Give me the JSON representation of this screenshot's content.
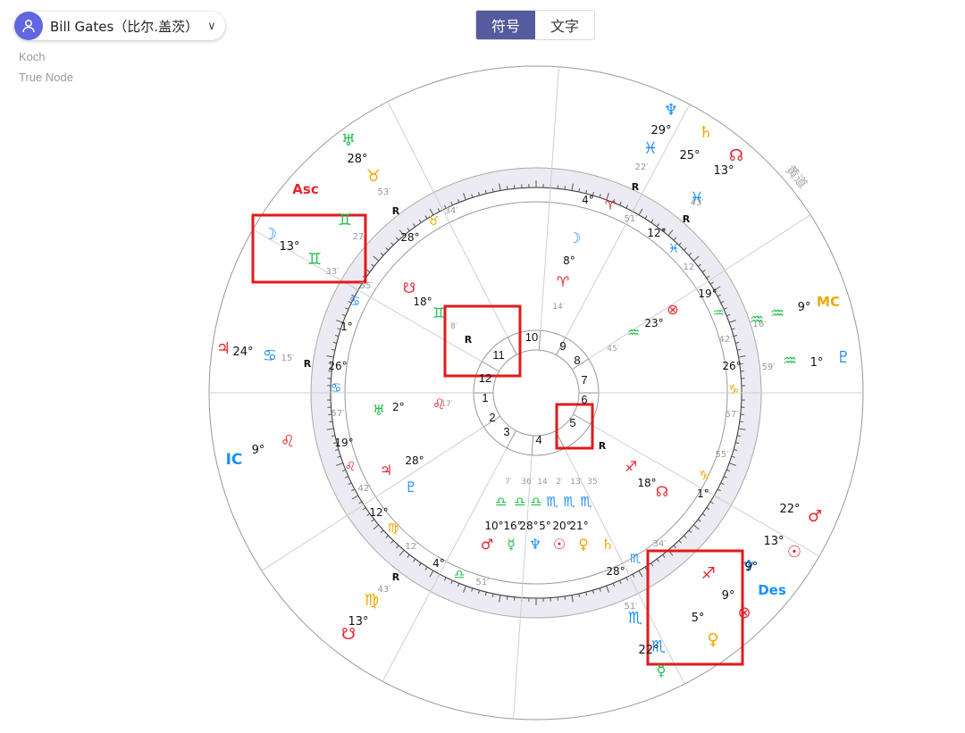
{
  "profile": {
    "name": "Bill Gates（比尔.盖茨）",
    "chevron": "∨"
  },
  "settings": {
    "house_system": "Koch",
    "node_type": "True Node"
  },
  "view_toggle": {
    "symbol_label": "符号",
    "text_label": "文字",
    "active": "symbol"
  },
  "colors": {
    "accent": "#565a9f",
    "fire": "#e8232a",
    "earth": "#f0a800",
    "air": "#1fbf4a",
    "water": "#1a8fff",
    "highlight": "#e21a1a"
  },
  "chart_labels": {
    "ecliptic": "黄道",
    "asc": "Asc",
    "mc": "MC",
    "ic": "IC",
    "des": "Des",
    "retro": "R"
  },
  "house_numbers": [
    "1",
    "2",
    "3",
    "4",
    "5",
    "6",
    "7",
    "8",
    "9",
    "10",
    "11",
    "12"
  ],
  "outer_ring": [
    {
      "glyph": "♅",
      "text": "28°",
      "glyph_color": "#1fbf4a"
    },
    {
      "glyph": "♉",
      "text": "53′",
      "glyph_color": "#f0a800"
    },
    {
      "glyph": "♆",
      "text": "29°",
      "glyph_color": "#1a8fff"
    },
    {
      "glyph": "♄",
      "text": "25°",
      "glyph_color": "#f0a800"
    },
    {
      "glyph": "☊",
      "text": "13°",
      "glyph_color": "#e8232a"
    },
    {
      "glyph": "♓",
      "text": "22′",
      "glyph_color": "#1a8fff"
    },
    {
      "glyph": "♓",
      "text": "43′",
      "glyph_color": "#1a8fff"
    },
    {
      "glyph": "☽",
      "text": "13°",
      "glyph_color": "#1a8fff"
    },
    {
      "glyph": "♊",
      "text": "27′",
      "glyph_color": "#1fbf4a"
    },
    {
      "glyph": "♊",
      "text": "33′",
      "glyph_color": "#1fbf4a"
    },
    {
      "glyph": "♃",
      "text": "24°",
      "glyph_color": "#e8232a"
    },
    {
      "glyph": "♋",
      "text": "15′",
      "glyph_color": "#1a8fff"
    },
    {
      "glyph": "♌",
      "text": "9°",
      "glyph_color": "#e8232a"
    },
    {
      "glyph": "☋",
      "text": "13°",
      "glyph_color": "#e8232a"
    },
    {
      "glyph": "♍",
      "text": "43′",
      "glyph_color": "#f0a800"
    },
    {
      "glyph": "♏",
      "text": "51′",
      "glyph_color": "#1a8fff"
    },
    {
      "glyph": "♏",
      "text": "22°",
      "glyph_color": "#1a8fff"
    },
    {
      "glyph": "☿",
      "text": "",
      "glyph_color": "#1fbf4a"
    },
    {
      "glyph": "♂",
      "text": "22°",
      "glyph_color": "#e8232a"
    },
    {
      "glyph": "☉",
      "text": "13°",
      "glyph_color": "#e8232a"
    },
    {
      "glyph": "♆",
      "text": "9°",
      "glyph_color": "#1a8fff"
    },
    {
      "glyph": "♐",
      "text": "9°",
      "glyph_color": "#e8232a"
    },
    {
      "glyph": "♀",
      "text": "5°",
      "glyph_color": "#f0a800"
    },
    {
      "glyph": "⊗",
      "text": "",
      "glyph_color": "#e8232a"
    },
    {
      "glyph": "♒",
      "text": "16′",
      "glyph_color": "#1fbf4a"
    },
    {
      "glyph": "♒",
      "text": "9°",
      "glyph_color": "#1fbf4a"
    },
    {
      "glyph": "♒",
      "text": "59′",
      "glyph_color": "#1fbf4a"
    },
    {
      "glyph": "♇",
      "text": "1°",
      "glyph_color": "#1a8fff"
    }
  ],
  "inner_ring": [
    {
      "glyph": "☽",
      "text": "8°",
      "glyph_color": "#1a8fff"
    },
    {
      "glyph": "♈",
      "text": "14′",
      "glyph_color": "#e8232a"
    },
    {
      "glyph": "⊗",
      "text": "23°",
      "glyph_color": "#e8232a"
    },
    {
      "glyph": "♒",
      "text": "45′",
      "glyph_color": "#1fbf4a"
    },
    {
      "glyph": "☋",
      "text": "18°",
      "glyph_color": "#e8232a"
    },
    {
      "glyph": "♊",
      "text": "8′",
      "glyph_color": "#1fbf4a"
    },
    {
      "glyph": "♅",
      "text": "2°",
      "glyph_color": "#1fbf4a"
    },
    {
      "glyph": "♌",
      "text": "17′",
      "glyph_color": "#e8232a"
    },
    {
      "glyph": "♃",
      "text": "28°",
      "glyph_color": "#e8232a"
    },
    {
      "glyph": "♇",
      "text": "",
      "glyph_color": "#1a8fff"
    },
    {
      "glyph": "♐",
      "text": "18°",
      "glyph_color": "#e8232a"
    },
    {
      "glyph": "☊",
      "text": "",
      "glyph_color": "#e8232a"
    }
  ],
  "cusp_labels": [
    {
      "glyph": "♉",
      "deg": "28°",
      "min": "34′",
      "glyph_color": "#f0a800"
    },
    {
      "glyph": "♈",
      "deg": "4°",
      "min": "51′",
      "glyph_color": "#e8232a"
    },
    {
      "glyph": "♓",
      "deg": "12°",
      "min": "12′",
      "glyph_color": "#1a8fff"
    },
    {
      "glyph": "♒",
      "deg": "19°",
      "min": "42′",
      "glyph_color": "#1fbf4a"
    },
    {
      "glyph": "♑",
      "deg": "26°",
      "min": "57′",
      "glyph_color": "#f0a800"
    },
    {
      "glyph": "♑",
      "deg": "1°",
      "min": "55′",
      "glyph_color": "#f0a800"
    },
    {
      "glyph": "♏",
      "deg": "28°",
      "min": "34′",
      "glyph_color": "#1a8fff"
    },
    {
      "glyph": "♎",
      "deg": "4°",
      "min": "51′",
      "glyph_color": "#1fbf4a"
    },
    {
      "glyph": "♍",
      "deg": "12°",
      "min": "12′",
      "glyph_color": "#f0a800"
    },
    {
      "glyph": "♌",
      "deg": "19°",
      "min": "42′",
      "glyph_color": "#e8232a"
    },
    {
      "glyph": "♋",
      "deg": "26°",
      "min": "57′",
      "glyph_color": "#1a8fff"
    },
    {
      "glyph": "♋",
      "deg": "1°",
      "min": "55′",
      "glyph_color": "#1a8fff"
    }
  ],
  "bottom_cluster": {
    "glyphs": [
      "♎",
      "♎",
      "♎",
      "♏",
      "♏",
      "♏"
    ],
    "degs": [
      "10°",
      "16°",
      "28°",
      "5°",
      "20°",
      "21°"
    ],
    "mins": [
      "7′",
      "36′",
      "14′",
      "2′",
      "13′",
      "35′"
    ],
    "planets": [
      "♂",
      "☿",
      "♆",
      "☉",
      "♀",
      "♄"
    ],
    "planet_colors": [
      "#e8232a",
      "#1fbf4a",
      "#1a8fff",
      "#e8232a",
      "#f0a800",
      "#f0a800"
    ]
  }
}
